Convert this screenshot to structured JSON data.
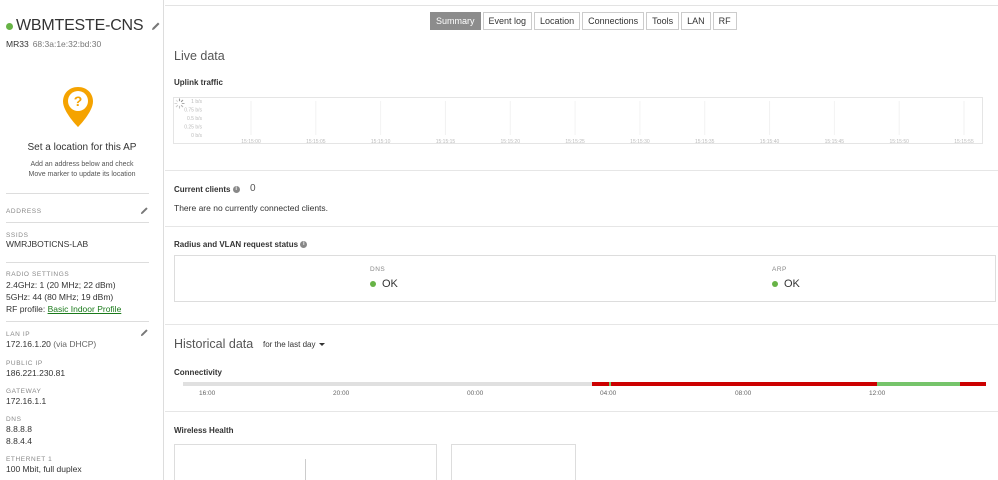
{
  "ap": {
    "name": "WBMTESTE-CNS",
    "model": "MR33",
    "mac": "68:3a:1e:32:bd:30",
    "status_color": "#67b346"
  },
  "location": {
    "title": "Set a location for this AP",
    "desc_line1": "Add an address below and check",
    "desc_line2": "Move marker to update its location",
    "pin_color": "#f5a300"
  },
  "sidebar": {
    "address_label": "ADDRESS",
    "ssids_label": "SSIDS",
    "ssids_value": "WMRJBOTICNS-LAB",
    "radio_label": "RADIO SETTINGS",
    "radio_24": "2.4GHz: 1 (20 MHz; 22 dBm)",
    "radio_5": "5GHz: 44 (80 MHz; 19 dBm)",
    "rf_profile_prefix": "RF profile:",
    "rf_profile_link": "Basic Indoor Profile",
    "lan_ip_label": "LAN IP",
    "lan_ip_value": "172.16.1.20",
    "lan_ip_suffix": "(via DHCP)",
    "public_ip_label": "PUBLIC IP",
    "public_ip_value": "186.221.230.81",
    "gateway_label": "GATEWAY",
    "gateway_value": "172.16.1.1",
    "dns_label": "DNS",
    "dns_1": "8.8.8.8",
    "dns_2": "8.8.4.4",
    "ethernet_label": "ETHERNET 1",
    "ethernet_value": "100 Mbit, full duplex"
  },
  "tabs": [
    "Summary",
    "Event log",
    "Location",
    "Connections",
    "Tools",
    "LAN",
    "RF"
  ],
  "active_tab": "Summary",
  "live": {
    "title": "Live data",
    "uplink_label": "Uplink traffic",
    "current_clients_label": "Current clients",
    "current_clients_count": "0",
    "no_clients_text": "There are no currently connected clients.",
    "radius_label": "Radius and VLAN request status",
    "dns_label": "DNS",
    "dns_status": "OK",
    "arp_label": "ARP",
    "arp_status": "OK"
  },
  "chart_data": {
    "type": "line",
    "title": "Uplink traffic",
    "y_ticks": [
      "1 b/s",
      "0.75 b/s",
      "0.5 b/s",
      "0.25 b/s",
      "0 b/s"
    ],
    "x_ticks": [
      "15:15:00",
      "15:15:05",
      "15:15:10",
      "15:15:15",
      "15:15:20",
      "15:15:25",
      "15:15:30",
      "15:15:35",
      "15:15:40",
      "15:15:45",
      "15:15:50",
      "15:15:55"
    ],
    "series": [],
    "ylim": [
      0,
      1
    ]
  },
  "historical": {
    "title": "Historical data",
    "range": "for the last day",
    "connectivity_label": "Connectivity",
    "ticks": [
      "16:00",
      "20:00",
      "00:00",
      "04:00",
      "08:00",
      "12:00"
    ],
    "segments": [
      {
        "start": 0.0,
        "end": 0.509,
        "color": "#e0e0e0"
      },
      {
        "start": 0.509,
        "end": 0.53,
        "color": "#cc0000"
      },
      {
        "start": 0.53,
        "end": 0.533,
        "color": "#76c46b"
      },
      {
        "start": 0.533,
        "end": 0.864,
        "color": "#cc0000"
      },
      {
        "start": 0.864,
        "end": 0.968,
        "color": "#76c46b"
      },
      {
        "start": 0.968,
        "end": 1.0,
        "color": "#cc0000"
      }
    ],
    "wireless_health_label": "Wireless Health"
  }
}
